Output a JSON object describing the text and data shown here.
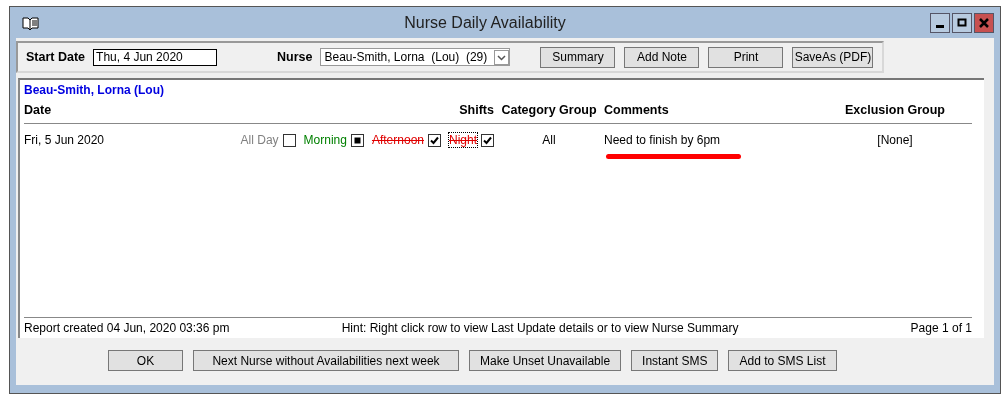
{
  "window": {
    "title": "Nurse Daily Availability"
  },
  "toolbar": {
    "start_date_label": "Start Date",
    "start_date": "Thu, 4 Jun 2020",
    "nurse_label": "Nurse",
    "nurse": "Beau-Smith, Lorna  (Lou)  (29)",
    "buttons": [
      "Summary",
      "Add Note",
      "Print",
      "SaveAs (PDF)"
    ]
  },
  "report": {
    "nurse_heading": "Beau-Smith, Lorna (Lou)",
    "columns": [
      "Date",
      "Shifts",
      "Category Group",
      "Comments",
      "Exclusion Group"
    ],
    "rows": [
      {
        "date": "Fri, 5 Jun 2020",
        "shifts": [
          {
            "label": "All Day",
            "color": "#808080",
            "struck": false,
            "checked": false,
            "indeterminate": false,
            "focused": false
          },
          {
            "label": "Morning",
            "color": "#008000",
            "struck": false,
            "checked": false,
            "indeterminate": true,
            "focused": false
          },
          {
            "label": "Afternoon",
            "color": "#e00000",
            "struck": true,
            "checked": true,
            "indeterminate": false,
            "focused": false
          },
          {
            "label": "Night",
            "color": "#e00000",
            "struck": true,
            "checked": true,
            "indeterminate": false,
            "focused": true
          }
        ],
        "category_group": "All",
        "comment": "Need to finish by 6pm",
        "comment_underlined": true,
        "exclusion_group": "[None]"
      }
    ],
    "footer": {
      "created": "Report created 04 Jun, 2020 03:36 pm",
      "hint": "Hint: Right click row to view Last Update details or to view Nurse Summary",
      "page": "Page 1 of 1"
    }
  },
  "buttons": [
    "OK",
    "Next Nurse without Availabilities next week",
    "Make Unset Unavailable",
    "Instant SMS",
    "Add to SMS List"
  ]
}
